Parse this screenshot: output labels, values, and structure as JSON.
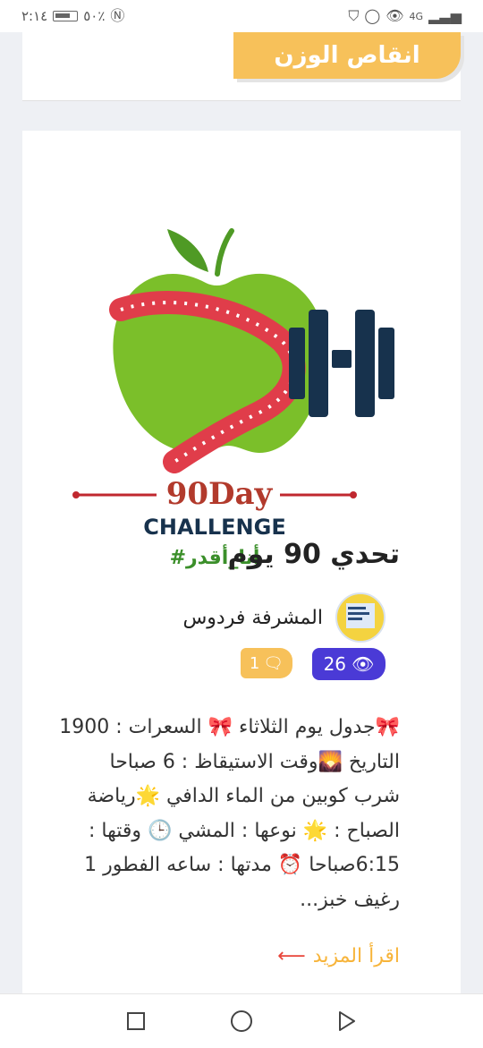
{
  "status_bar": {
    "time": "٢:١٤",
    "battery": "٥٠٪",
    "network": "4G"
  },
  "top_card": {
    "category_label": "انقاص الوزن"
  },
  "post": {
    "image": {
      "day_text": "90Day",
      "challenge_text": "CHALLENGE",
      "hashtag_text": "#أنا_أقدر"
    },
    "title": "تحدي 90 يوم",
    "author": "المشرفة فردوس",
    "views": "26",
    "comments": "1",
    "excerpt": "🎀جدول يوم الثلاثاء 🎀 السعرات : 1900 التاريخ 🌄وقت الاستيقاظ : 6 صباحا شرب كوبين من الماء الدافي 🌟رياضة الصباح : 🌟 نوعها : المشي 🕒 وقتها : 6:15صباحا ⏰ مدتها : ساعه الفطور 1 رغيف خبز...",
    "read_more": "اقرأ المزيد"
  },
  "nav_bar": {
    "icons": [
      "recent-apps-icon",
      "home-icon",
      "back-icon"
    ]
  },
  "colors": {
    "accent_yellow": "#f7c15a",
    "badge_purple": "#4a3ad6",
    "apple_green": "#7bbf2a",
    "tape_red": "#e03d4a",
    "dumbbell_navy": "#17324d"
  }
}
